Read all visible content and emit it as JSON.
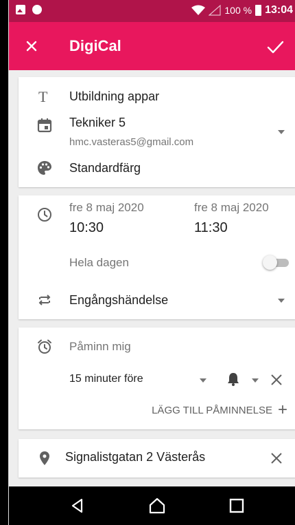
{
  "status_bar": {
    "battery_text": "100 %",
    "time": "13:04",
    "left_icons": [
      "image-icon",
      "notification-icon"
    ],
    "right_icons": [
      "wifi-icon",
      "signal-icon",
      "battery-icon"
    ]
  },
  "toolbar": {
    "title": "DigiCal",
    "close_icon": "close-icon",
    "save_icon": "check-icon",
    "color": "#e8175d",
    "status_color": "#b0144a"
  },
  "details": {
    "title_value": "Utbildning appar",
    "calendar_name": "Tekniker 5",
    "calendar_account": "hmc.vasteras5@gmail.com",
    "color_label": "Standardfärg"
  },
  "time": {
    "start_date": "fre 8 maj 2020",
    "start_time": "10:30",
    "end_date": "fre 8 maj 2020",
    "end_time": "11:30",
    "all_day_label": "Hela dagen",
    "all_day_on": false,
    "repeat_label": "Engångshändelse"
  },
  "reminders": {
    "header": "Påminn mig",
    "items": [
      {
        "time": "15 minuter före",
        "type_icon": "bell-icon"
      }
    ],
    "add_label": "LÄGG TILL PÅMINNELSE",
    "add_symbol": "+"
  },
  "location": {
    "value": "Signalistgatan 2 Västerås"
  },
  "nav": {
    "buttons": [
      "back-icon",
      "home-icon",
      "recents-icon"
    ]
  }
}
